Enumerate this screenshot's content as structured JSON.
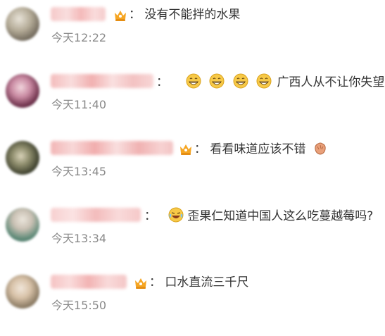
{
  "comments": [
    {
      "text": "没有不能拌的水果",
      "separator": "：",
      "time": "今天12:22",
      "badge_icon": "crown-badge-icon"
    },
    {
      "text": "广西人从不让你失望",
      "separator": "：",
      "time": "今天11:40",
      "emojis": [
        "grinning-face-icon",
        "grinning-face-icon",
        "grinning-face-icon",
        "grinning-face-icon"
      ]
    },
    {
      "text": "看看味道应该不错",
      "separator": "：",
      "time": "今天13:45",
      "badge_icon": "crown-badge-icon",
      "trailing_emoji": "clapping-hands-icon"
    },
    {
      "text": "歪果仁知道中国人这么吃蔓越莓吗?",
      "separator": "：",
      "time": "今天13:34",
      "leading_emoji": "laughing-tears-icon"
    },
    {
      "text": "口水直流三千尺",
      "separator": "：",
      "time": "今天15:50",
      "badge_icon": "crown-badge-icon"
    }
  ],
  "colors": {
    "timestamp": "#8a8a8a",
    "text": "#333333",
    "crown": "#f6a623",
    "emoji_yellow": "#f7c948"
  }
}
